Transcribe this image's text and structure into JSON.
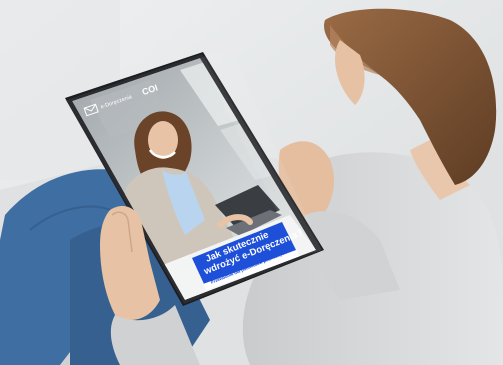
{
  "tablet": {
    "brand_text": "e-Doręczenia",
    "partner_logo": "COI",
    "headline_line1": "Jak skutecznie",
    "headline_line2": "wdrożyć e-Doręczenia?",
    "subtitle": "Przewodnik dla podmiotów publicznych"
  },
  "colors": {
    "accent_blue": "#1e4fd8",
    "shirt_blue": "#b9d4ef",
    "blazer_beige": "#cfc6bb",
    "sweater_gray": "#d6d8d9",
    "jeans_blue": "#3f6ea3"
  },
  "icons": [
    "mail-icon"
  ]
}
